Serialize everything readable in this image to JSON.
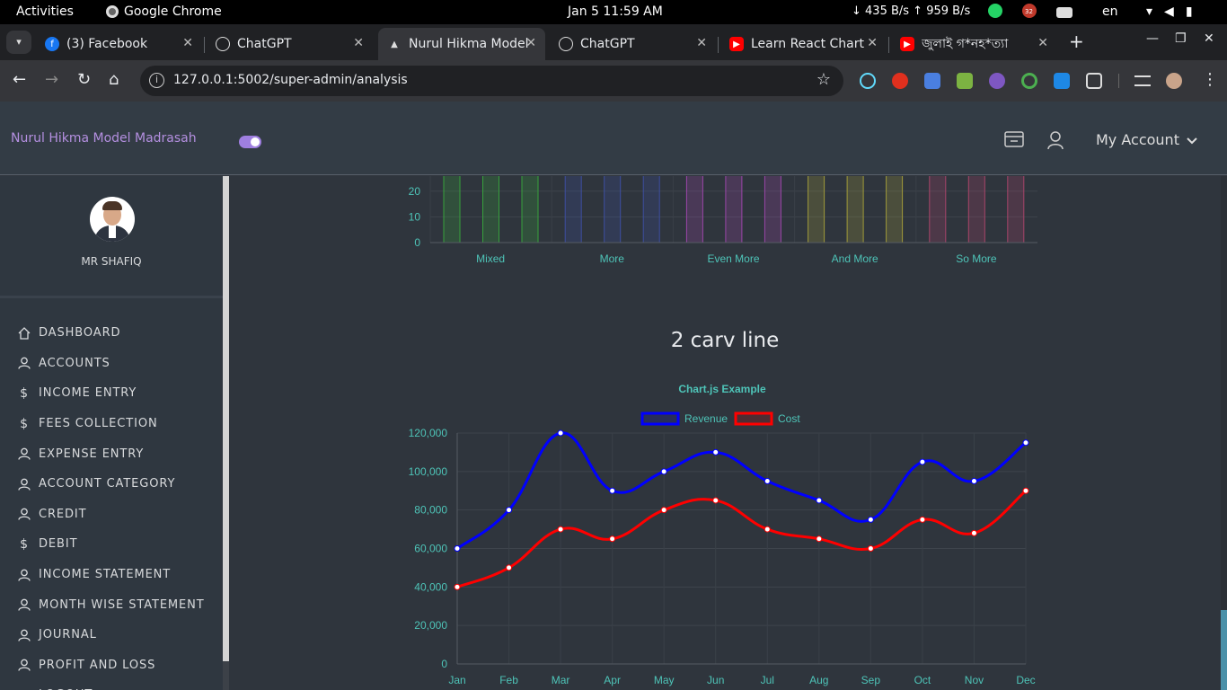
{
  "os_bar": {
    "activities": "Activities",
    "app_name": "Google Chrome",
    "clock": "Jan 5  11:59 AM",
    "net_speed": "↓ 435 B/s ↑ 959 B/s",
    "lang": "en",
    "notification_badge": "32"
  },
  "tabs": [
    {
      "label": "(3) Facebook",
      "icon": "facebook-icon"
    },
    {
      "label": "ChatGPT",
      "icon": "chatgpt-icon"
    },
    {
      "label": "Nurul Hikma Model",
      "icon": "app-icon"
    },
    {
      "label": "ChatGPT",
      "icon": "chatgpt-icon"
    },
    {
      "label": "Learn React Chart",
      "icon": "youtube-icon"
    },
    {
      "label": "জুলাই গ*নহ*ত্যা",
      "icon": "youtube-icon"
    }
  ],
  "browser": {
    "url": "127.0.0.1:5002/super-admin/analysis"
  },
  "header": {
    "brand": "Nurul Hikma Model Madrasah",
    "account_label": "My Account"
  },
  "profile": {
    "name": "MR SHAFIQ"
  },
  "menu": [
    {
      "label": "DASHBOARD",
      "icon": "home-icon"
    },
    {
      "label": "ACCOUNTS",
      "icon": "user-icon"
    },
    {
      "label": "INCOME ENTRY",
      "icon": "dollar-icon"
    },
    {
      "label": "FEES COLLECTION",
      "icon": "dollar-icon"
    },
    {
      "label": "EXPENSE ENTRY",
      "icon": "user-icon"
    },
    {
      "label": "ACCOUNT CATEGORY",
      "icon": "user-icon"
    },
    {
      "label": "CREDIT",
      "icon": "user-icon"
    },
    {
      "label": "DEBIT",
      "icon": "dollar-icon"
    },
    {
      "label": "INCOME STATEMENT",
      "icon": "user-icon"
    },
    {
      "label": "MONTH WISE STATEMENT",
      "icon": "user-icon"
    },
    {
      "label": "JOURNAL",
      "icon": "user-icon"
    },
    {
      "label": "PROFIT AND LOSS",
      "icon": "user-icon"
    },
    {
      "label": "LOGOUT",
      "icon": "power-icon"
    }
  ],
  "section_title": "2 carv line",
  "chart_data": [
    {
      "type": "bar",
      "categories": [
        "Mixed",
        "More",
        "Even More",
        "And More",
        "So More"
      ],
      "bars_per_category": 3,
      "colors": [
        "#37a23c",
        "#3d4fa0",
        "#9a46a8",
        "#a09a3a",
        "#a8456a"
      ],
      "values": [
        [
          30,
          30,
          30
        ],
        [
          30,
          30,
          30
        ],
        [
          30,
          30,
          30
        ],
        [
          30,
          30,
          30
        ],
        [
          30,
          30,
          30
        ]
      ],
      "y_ticks": [
        "0",
        "10",
        "20"
      ],
      "note": "partially scrolled out of view at top"
    },
    {
      "type": "line",
      "title": "Chart.js Example",
      "categories": [
        "Jan",
        "Feb",
        "Mar",
        "Apr",
        "May",
        "Jun",
        "Jul",
        "Aug",
        "Sep",
        "Oct",
        "Nov",
        "Dec"
      ],
      "series": [
        {
          "name": "Revenue",
          "color": "#0000ff",
          "values": [
            60000,
            80000,
            120000,
            90000,
            100000,
            110000,
            95000,
            85000,
            75000,
            105000,
            95000,
            115000
          ]
        },
        {
          "name": "Cost",
          "color": "#ff0000",
          "values": [
            40000,
            50000,
            70000,
            65000,
            80000,
            85000,
            70000,
            65000,
            60000,
            75000,
            68000,
            90000
          ]
        }
      ],
      "ylim": [
        0,
        120000
      ],
      "y_ticks": [
        "0",
        "20,000",
        "40,000",
        "60,000",
        "80,000",
        "100,000",
        "120,000"
      ],
      "legend": "top",
      "grid": true
    }
  ]
}
